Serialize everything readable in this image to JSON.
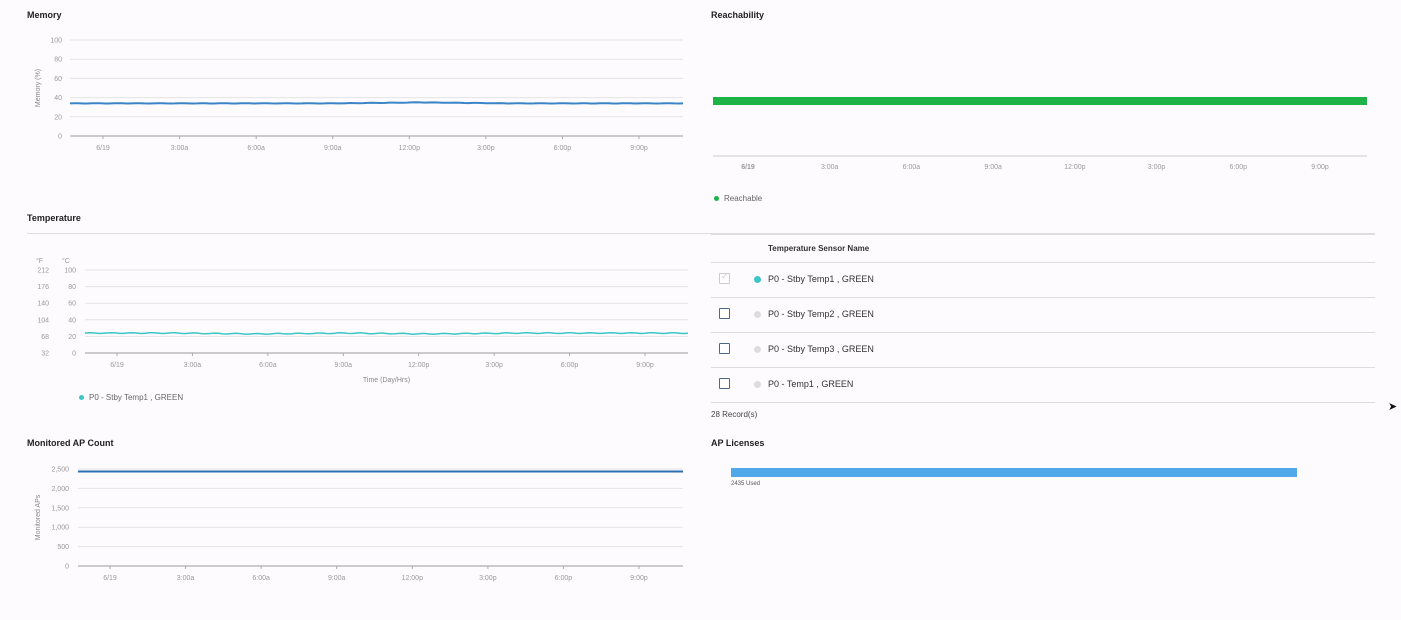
{
  "memory": {
    "title": "Memory",
    "ylabel": "Memory (%)",
    "yticks": [
      "100",
      "80",
      "60",
      "40",
      "20",
      "0"
    ],
    "xticks": [
      "6/19",
      "3:00a",
      "6:00a",
      "9:00a",
      "12:00p",
      "3:00p",
      "6:00p",
      "9:00p"
    ],
    "line_color": "#3a85c8"
  },
  "reachability": {
    "title": "Reachability",
    "xticks": [
      "6/19",
      "3:00a",
      "6:00a",
      "9:00a",
      "12:00p",
      "3:00p",
      "6:00p",
      "9:00p"
    ],
    "legend": "Reachable",
    "bar_color": "#1db347"
  },
  "temperature": {
    "title": "Temperature",
    "unit_f": "°F",
    "unit_c": "°C",
    "yticks_f": [
      "212",
      "176",
      "140",
      "104",
      "68",
      "32"
    ],
    "yticks_c": [
      "100",
      "80",
      "60",
      "40",
      "20",
      "0"
    ],
    "xticks": [
      "6/19",
      "3:00a",
      "6:00a",
      "9:00a",
      "12:00p",
      "3:00p",
      "6:00p",
      "9:00p"
    ],
    "xlabel": "Time (Day/Hrs)",
    "legend": "P0 - Stby Temp1 , GREEN",
    "line_color": "#3cc6c6"
  },
  "sensor_table": {
    "header": "Temperature Sensor Name",
    "rows": [
      {
        "label": "P0 - Stby Temp1 , GREEN",
        "checked": true,
        "dot_color": "#3cc6c6"
      },
      {
        "label": "P0 - Stby Temp2 , GREEN",
        "checked": false,
        "dot_color": "#dddddd"
      },
      {
        "label": "P0 - Stby Temp3 , GREEN",
        "checked": false,
        "dot_color": "#dddddd"
      },
      {
        "label": "P0 - Temp1 , GREEN",
        "checked": false,
        "dot_color": "#dddddd"
      }
    ],
    "records": "28 Record(s)"
  },
  "ap_count": {
    "title": "Monitored AP Count",
    "ylabel": "Monitored APs",
    "yticks": [
      "2,500",
      "2,000",
      "1,500",
      "1,000",
      "500",
      "0"
    ],
    "xticks": [
      "6/19",
      "3:00a",
      "6:00a",
      "9:00a",
      "12:00p",
      "3:00p",
      "6:00p",
      "9:00p"
    ],
    "line_color": "#2c6fb0"
  },
  "ap_licenses": {
    "title": "AP Licenses",
    "used_label": "2435 Used",
    "bar_color": "#4ea8ea"
  },
  "chart_data": [
    {
      "type": "line",
      "title": "Memory",
      "ylabel": "Memory (%)",
      "ylim": [
        0,
        100
      ],
      "x": [
        "6/19",
        "3:00a",
        "6:00a",
        "9:00a",
        "12:00p",
        "3:00p",
        "6:00p",
        "9:00p"
      ],
      "series": [
        {
          "values": [
            34,
            34,
            34,
            34,
            35,
            34,
            34,
            34
          ]
        }
      ]
    },
    {
      "type": "line",
      "title": "Temperature",
      "xlabel": "Time (Day/Hrs)",
      "ylim": [
        0,
        100
      ],
      "x": [
        "6/19",
        "3:00a",
        "6:00a",
        "9:00a",
        "12:00p",
        "3:00p",
        "6:00p",
        "9:00p"
      ],
      "series": [
        {
          "name": "P0 - Stby Temp1 , GREEN",
          "values": [
            24,
            24,
            23,
            24,
            23,
            24,
            24,
            24
          ]
        }
      ]
    },
    {
      "type": "line",
      "title": "Monitored AP Count",
      "ylabel": "Monitored APs",
      "ylim": [
        0,
        2500
      ],
      "x": [
        "6/19",
        "3:00a",
        "6:00a",
        "9:00a",
        "12:00p",
        "3:00p",
        "6:00p",
        "9:00p"
      ],
      "series": [
        {
          "values": [
            2435,
            2435,
            2435,
            2435,
            2435,
            2435,
            2435,
            2435
          ]
        }
      ]
    }
  ]
}
